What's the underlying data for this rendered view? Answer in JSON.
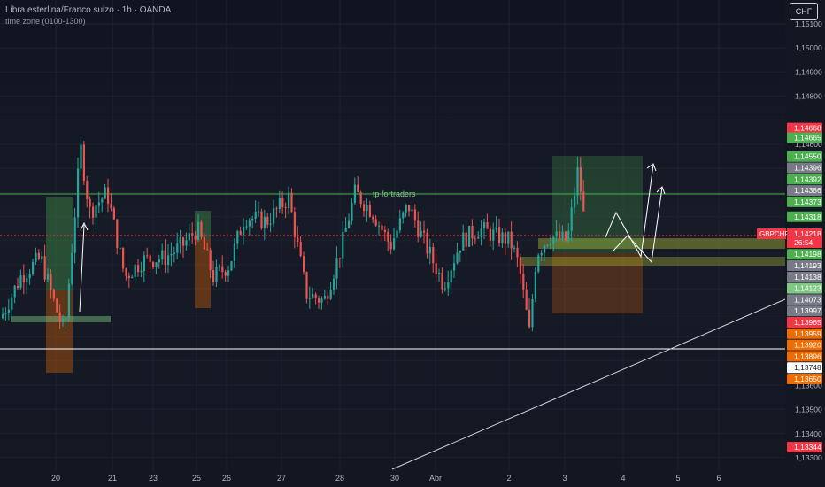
{
  "header": {
    "title": "Libra esterlina/Franco suizo · 1h · OANDA",
    "subtitle": "time zone (0100-1300)",
    "currency_button": "CHF"
  },
  "chart_data": {
    "type": "candlestick",
    "symbol": "GBPCHF",
    "ylim": [
      1.1324,
      1.1517
    ],
    "price_axis_ticks": [
      "1,15100",
      "1,15000",
      "1,14900",
      "1,14800",
      "1,14600",
      "1,13600",
      "1,13500",
      "1,13400",
      "1,13300"
    ],
    "x_tick_labels": [
      "20",
      "21",
      "23",
      "25",
      "26",
      "27",
      "28",
      "30",
      "Abr",
      "2",
      "3",
      "4",
      "5",
      "6"
    ],
    "current_price": "1,14218",
    "countdown": "26:54",
    "annotation": "tp fortraders",
    "price_labels": [
      {
        "text": "1,14668",
        "color": "#f23645",
        "value": 1.14668
      },
      {
        "text": "1,14665",
        "color": "#4caf50",
        "value": 1.14628
      },
      {
        "text": "1,14550",
        "color": "#4caf50",
        "value": 1.1455
      },
      {
        "text": "1,14396",
        "color": "#787b86",
        "value": 1.14503
      },
      {
        "text": "1,14392",
        "color": "#4caf50",
        "value": 1.14456
      },
      {
        "text": "1,14386",
        "color": "#787b86",
        "value": 1.14409
      },
      {
        "text": "1,14373",
        "color": "#4caf50",
        "value": 1.14362
      },
      {
        "text": "1,14318",
        "color": "#4caf50",
        "value": 1.143
      },
      {
        "text": "1,14198",
        "color": "#4caf50",
        "value": 1.14144
      },
      {
        "text": "1,14193",
        "color": "#787b86",
        "value": 1.14097
      },
      {
        "text": "1,14138",
        "color": "#787b86",
        "value": 1.1405
      },
      {
        "text": "1,14123",
        "color": "#81c784",
        "value": 1.14003
      },
      {
        "text": "1,14073",
        "color": "#787b86",
        "value": 1.13956
      },
      {
        "text": "1,13997",
        "color": "#787b86",
        "value": 1.13909
      },
      {
        "text": "1,13965",
        "color": "#f23645",
        "value": 1.13862
      },
      {
        "text": "1,13959",
        "color": "#ef6c00",
        "value": 1.13815
      },
      {
        "text": "1,13920",
        "color": "#ef6c00",
        "value": 1.13768
      },
      {
        "text": "1,13896",
        "color": "#ef6c00",
        "value": 1.13721
      },
      {
        "text": "1,13748",
        "color": "#ffffff",
        "value": 1.13674
      },
      {
        "text": "1,13650",
        "color": "#ef6c00",
        "value": 1.13627
      },
      {
        "text": "1,13344",
        "color": "#f23645",
        "value": 1.13344
      }
    ],
    "colors": {
      "up": "#26a69a",
      "down": "#ef5350",
      "bg": "#131722",
      "grid": "#1e2230"
    }
  }
}
